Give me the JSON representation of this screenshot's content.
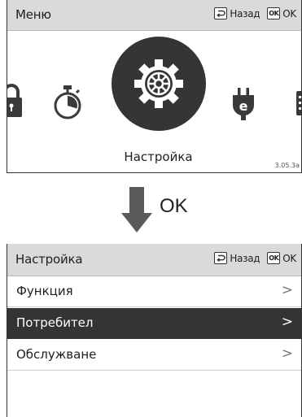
{
  "panel1": {
    "title": "Меню",
    "nav": {
      "back_label": "Назад",
      "ok_key": "OK",
      "ok_label": "OK"
    },
    "carousel": {
      "items": [
        "lock-icon",
        "timer-icon",
        "gear-icon",
        "plug-icon",
        "next-item-icon"
      ],
      "selected_label": "Настройка",
      "version": "3.05.3a"
    }
  },
  "transition": {
    "arrow_icon": "arrow-down-icon",
    "label": "OK"
  },
  "panel2": {
    "title": "Настройка",
    "nav": {
      "back_label": "Назад",
      "ok_key": "OK",
      "ok_label": "OK"
    },
    "menu": [
      {
        "label": "Функция",
        "chevron": ">",
        "selected": false
      },
      {
        "label": "Потребител",
        "chevron": ">",
        "selected": true
      },
      {
        "label": "Обслужване",
        "chevron": ">",
        "selected": false
      }
    ]
  },
  "colors": {
    "titlebar": "#dadada",
    "selected": "#343434",
    "text": "#1e1e1e"
  }
}
